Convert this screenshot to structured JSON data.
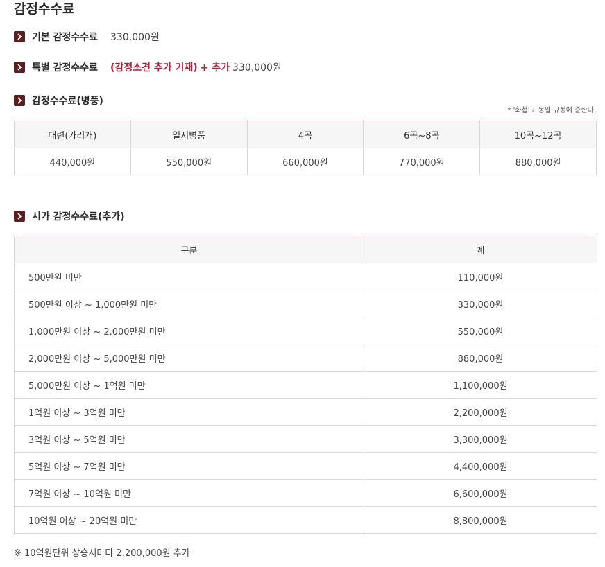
{
  "title": "감정수수료",
  "basic": {
    "label": "기본 감정수수료",
    "value": "330,000원"
  },
  "special": {
    "label": "특별 감정수수료",
    "note": "(감정소견 추가 기재)",
    "plus": "+ 추가",
    "value": "330,000원"
  },
  "folding_screen": {
    "label": "감정수수료(병풍)",
    "note": "* '화첩'도 동일 규정에 준한다.",
    "headers": [
      "대련(가리개)",
      "일지병풍",
      "4곡",
      "6곡~8곡",
      "10곡~12곡"
    ],
    "values": [
      "440,000원",
      "550,000원",
      "660,000원",
      "770,000원",
      "880,000원"
    ]
  },
  "market_value": {
    "label": "시가 감정수수료(추가)",
    "headers": [
      "구분",
      "계"
    ],
    "rows": [
      [
        "500만원 미만",
        "110,000원"
      ],
      [
        "500만원 이상 ~ 1,000만원 미만",
        "330,000원"
      ],
      [
        "1,000만원 이상 ~ 2,000만원 미만",
        "550,000원"
      ],
      [
        "2,000만원 이상 ~ 5,000만원 미만",
        "880,000원"
      ],
      [
        "5,000만원 이상 ~ 1억원 미만",
        "1,100,000원"
      ],
      [
        "1억원 이상 ~ 3억원 미만",
        "2,200,000원"
      ],
      [
        "3억원 이상 ~ 5억원 미만",
        "3,300,000원"
      ],
      [
        "5억원 이상 ~ 7억원 미만",
        "4,400,000원"
      ],
      [
        "7억원 이상 ~ 10억원 미만",
        "6,600,000원"
      ],
      [
        "10억원 이상 ~ 20억원 미만",
        "8,800,000원"
      ]
    ]
  },
  "footnote": "※ 10억원단위 상승시마다 2,200,000원 추가",
  "colors": {
    "bullet": "#5a2020",
    "accent_red": "#a8253e",
    "table_top_border": "#4a2a2a",
    "header_bg": "#f6f6f6"
  },
  "icons": {
    "bullet": "chevron-right-icon"
  }
}
